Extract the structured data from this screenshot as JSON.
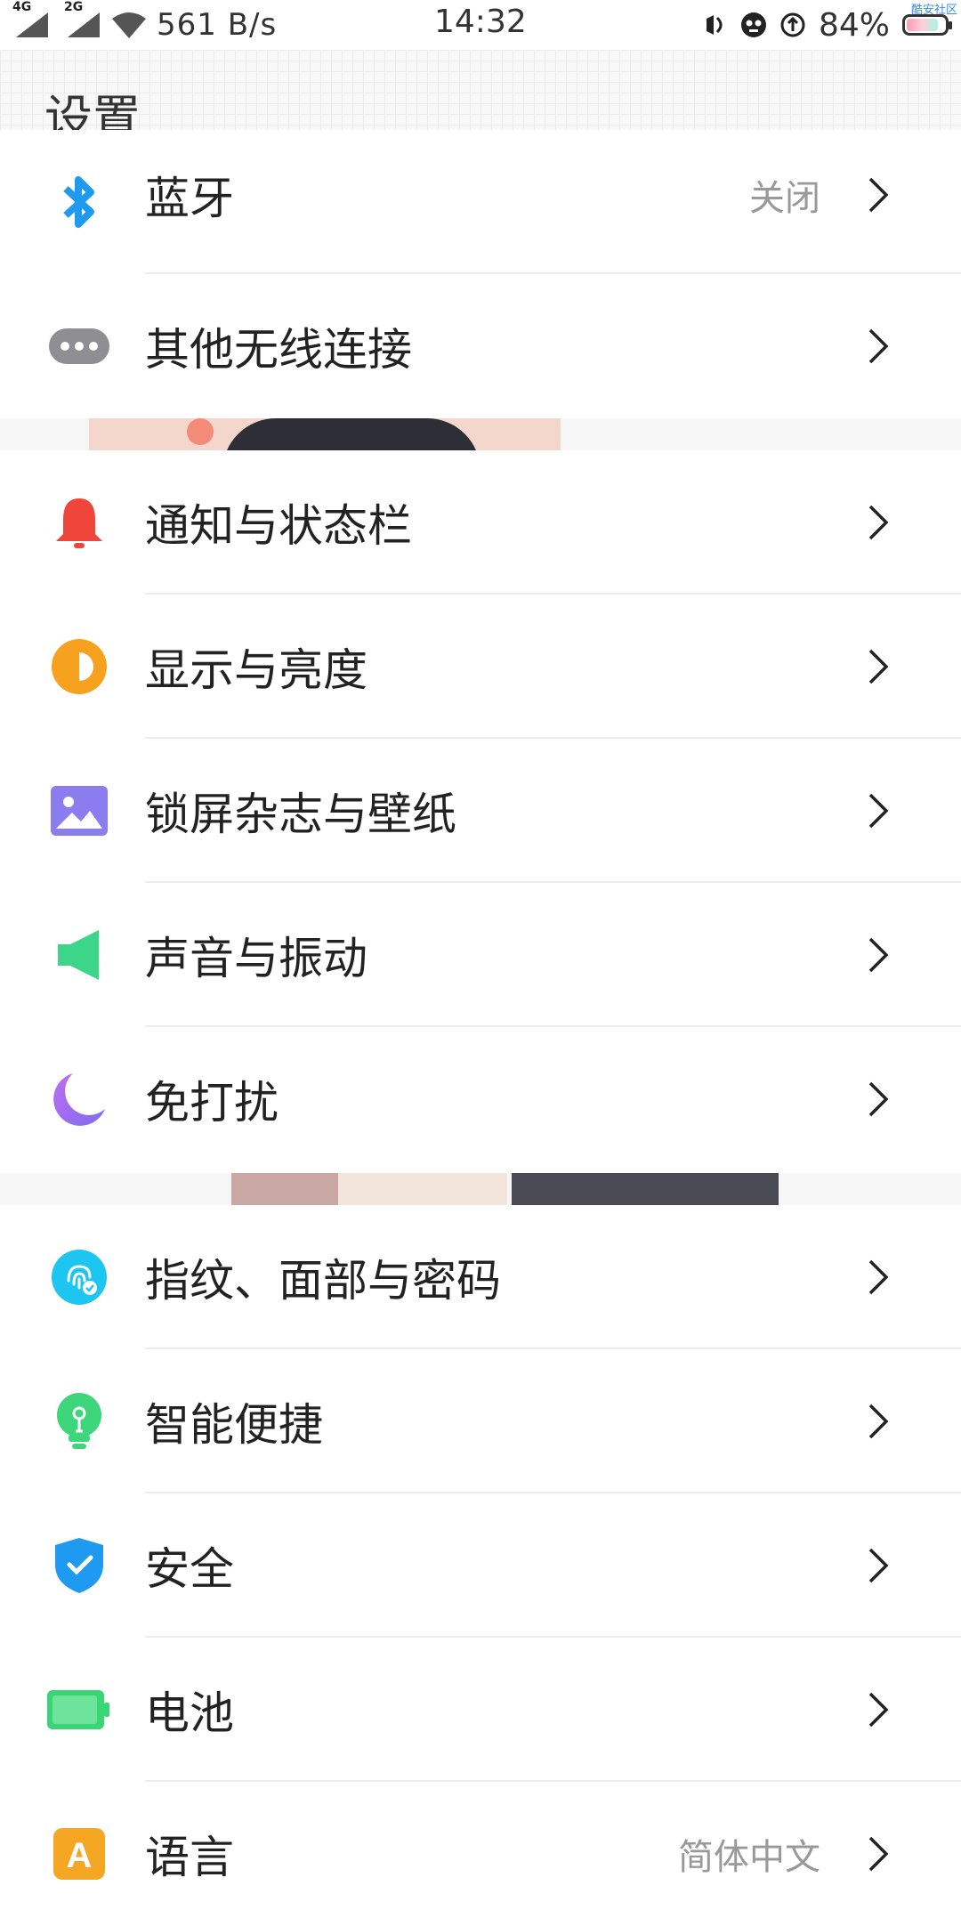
{
  "status_bar": {
    "net1": "4G",
    "net2": "2G",
    "speed": "561 B/s",
    "time": "14:32",
    "battery_pct": "84%",
    "battery_level": 0.84,
    "watermark": "酷安社区"
  },
  "header": {
    "title": "设置"
  },
  "settings": [
    {
      "label": "蓝牙",
      "value": "关闭",
      "icon": "bluetooth-icon"
    },
    {
      "label": "其他无线连接",
      "value": "",
      "icon": "more-dots-icon"
    },
    {
      "label": "通知与状态栏",
      "value": "",
      "icon": "bell-icon"
    },
    {
      "label": "显示与亮度",
      "value": "",
      "icon": "brightness-icon"
    },
    {
      "label": "锁屏杂志与壁纸",
      "value": "",
      "icon": "wallpaper-icon"
    },
    {
      "label": "声音与振动",
      "value": "",
      "icon": "speaker-icon"
    },
    {
      "label": "免打扰",
      "value": "",
      "icon": "moon-icon"
    },
    {
      "label": "指纹、面部与密码",
      "value": "",
      "icon": "fingerprint-icon"
    },
    {
      "label": "智能便捷",
      "value": "",
      "icon": "lightbulb-icon"
    },
    {
      "label": "安全",
      "value": "",
      "icon": "shield-icon"
    },
    {
      "label": "电池",
      "value": "",
      "icon": "battery-icon"
    },
    {
      "label": "语言",
      "value": "简体中文",
      "icon": "language-icon"
    }
  ],
  "colors": {
    "bluetooth": "#1e9bf0",
    "dots": "#8e8e93",
    "bell": "#f0453a",
    "brightness": "#f7a21e",
    "wallpaper": "#8b7cf0",
    "speaker": "#3cd68a",
    "moon": "#9d6cf0",
    "fingerprint": "#1cc6f0",
    "lightbulb": "#3ed67a",
    "shield": "#1e9bf0",
    "battery": "#39d576",
    "language": "#f5a623"
  }
}
